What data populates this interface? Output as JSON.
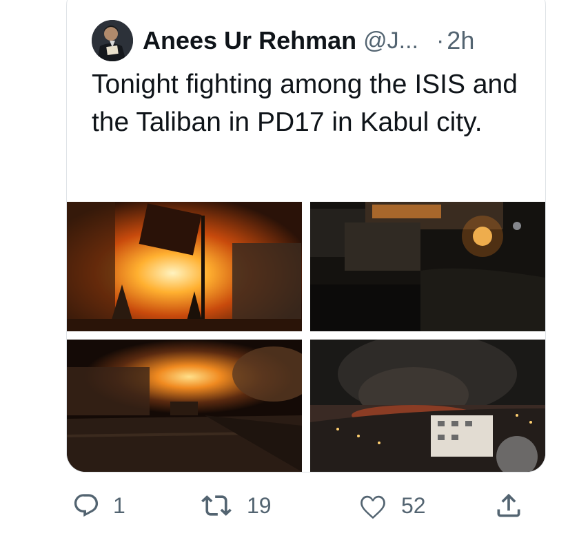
{
  "tweet": {
    "author_name": "Anees Ur Rehman",
    "handle": "@J...",
    "separator": "·",
    "time": "2h",
    "text": "Tonight fighting among the ISIS and the Taliban in PD17 in Kabul city.",
    "avatar_icon": "person-reading-avatar-icon"
  },
  "media": {
    "count": 4
  },
  "actions": {
    "reply": {
      "icon": "reply-icon",
      "count": "1"
    },
    "retweet": {
      "icon": "retweet-icon",
      "count": "19"
    },
    "like": {
      "icon": "heart-icon",
      "count": "52"
    },
    "share": {
      "icon": "share-icon"
    }
  },
  "colors": {
    "text": "#0f1419",
    "secondary": "#536471",
    "border": "#dfe3e7"
  }
}
